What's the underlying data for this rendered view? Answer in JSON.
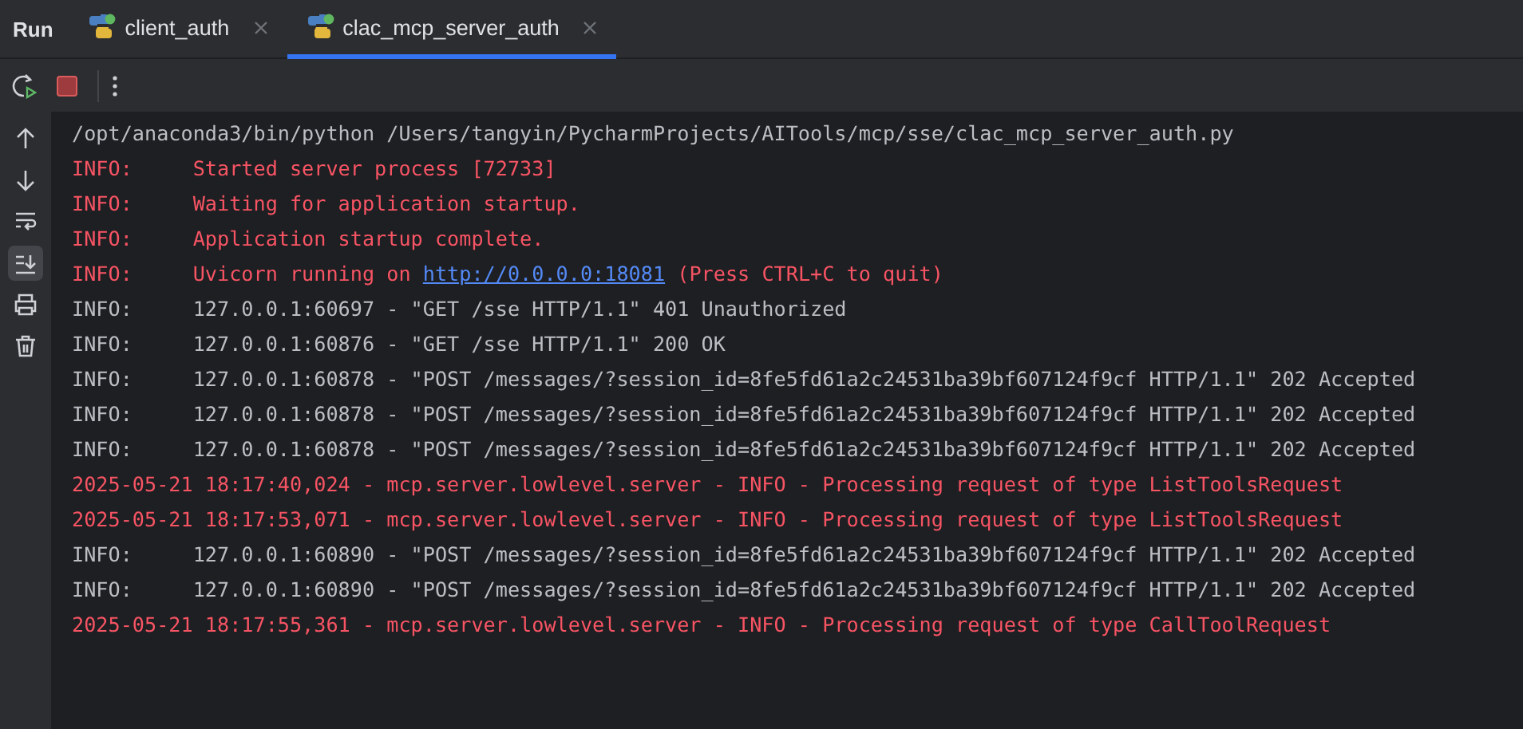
{
  "panel": {
    "title": "Run"
  },
  "tabs": [
    {
      "label": "client_auth",
      "selected": false
    },
    {
      "label": "clac_mcp_server_auth",
      "selected": true
    }
  ],
  "toolbar": [
    {
      "kind": "rerun"
    },
    {
      "kind": "stop"
    },
    {
      "kind": "more"
    }
  ],
  "side_tools": [
    {
      "kind": "up",
      "selected": false
    },
    {
      "kind": "down",
      "selected": false
    },
    {
      "kind": "wrap",
      "selected": false
    },
    {
      "kind": "scroll_end",
      "selected": true
    },
    {
      "kind": "print",
      "selected": false
    },
    {
      "kind": "trash",
      "selected": false
    }
  ],
  "console": [
    {
      "kind": "plain",
      "text": "/opt/anaconda3/bin/python /Users/tangyin/PycharmProjects/AITools/mcp/sse/clac_mcp_server_auth.py"
    },
    {
      "kind": "error",
      "text": "INFO:     Started server process [72733]"
    },
    {
      "kind": "error",
      "text": "INFO:     Waiting for application startup."
    },
    {
      "kind": "error",
      "text": "INFO:     Application startup complete."
    },
    {
      "kind": "error",
      "text": "INFO:     Uvicorn running on ",
      "link": "http://0.0.0.0:18081",
      "after": " (Press CTRL+C to quit)"
    },
    {
      "kind": "plain",
      "text": "INFO:     127.0.0.1:60697 - \"GET /sse HTTP/1.1\" 401 Unauthorized"
    },
    {
      "kind": "plain",
      "text": "INFO:     127.0.0.1:60876 - \"GET /sse HTTP/1.1\" 200 OK"
    },
    {
      "kind": "plain",
      "text": "INFO:     127.0.0.1:60878 - \"POST /messages/?session_id=8fe5fd61a2c24531ba39bf607124f9cf HTTP/1.1\" 202 Accepted"
    },
    {
      "kind": "plain",
      "text": "INFO:     127.0.0.1:60878 - \"POST /messages/?session_id=8fe5fd61a2c24531ba39bf607124f9cf HTTP/1.1\" 202 Accepted"
    },
    {
      "kind": "plain",
      "text": "INFO:     127.0.0.1:60878 - \"POST /messages/?session_id=8fe5fd61a2c24531ba39bf607124f9cf HTTP/1.1\" 202 Accepted"
    },
    {
      "kind": "error",
      "text": "2025-05-21 18:17:40,024 - mcp.server.lowlevel.server - INFO - Processing request of type ListToolsRequest"
    },
    {
      "kind": "error",
      "text": "2025-05-21 18:17:53,071 - mcp.server.lowlevel.server - INFO - Processing request of type ListToolsRequest"
    },
    {
      "kind": "plain",
      "text": "INFO:     127.0.0.1:60890 - \"POST /messages/?session_id=8fe5fd61a2c24531ba39bf607124f9cf HTTP/1.1\" 202 Accepted"
    },
    {
      "kind": "plain",
      "text": "INFO:     127.0.0.1:60890 - \"POST /messages/?session_id=8fe5fd61a2c24531ba39bf607124f9cf HTTP/1.1\" 202 Accepted"
    },
    {
      "kind": "error",
      "text": "2025-05-21 18:17:55,361 - mcp.server.lowlevel.server - INFO - Processing request of type CallToolRequest"
    }
  ]
}
